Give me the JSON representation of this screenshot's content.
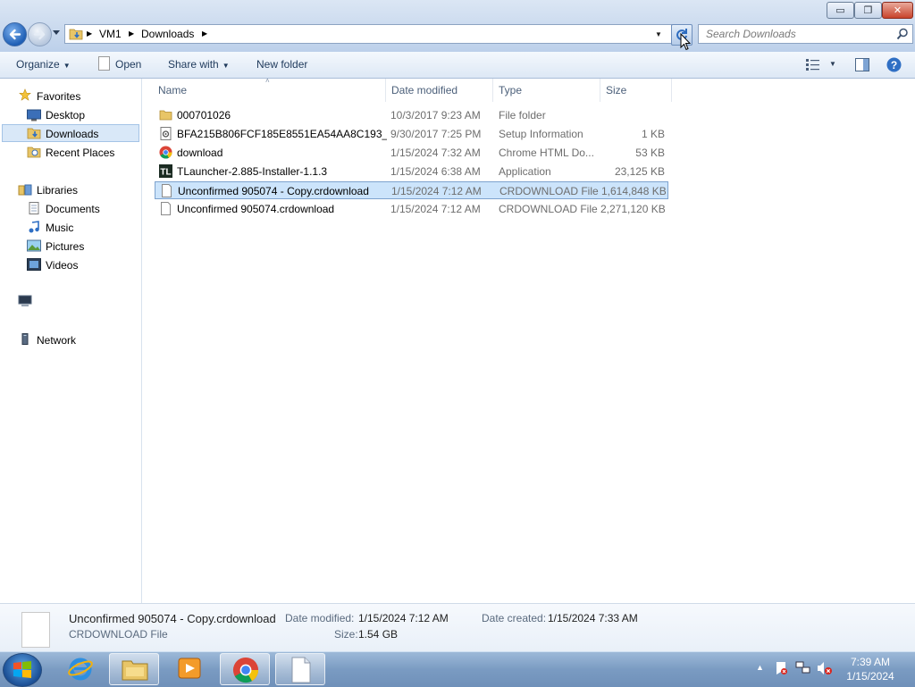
{
  "window": {
    "min_label": "▭",
    "max_label": "❐",
    "close_label": "✕"
  },
  "address": {
    "crumbs": [
      "VM1",
      "Downloads"
    ]
  },
  "search": {
    "placeholder": "Search Downloads"
  },
  "toolbar": {
    "organize": "Organize",
    "open": "Open",
    "share_with": "Share with",
    "new_folder": "New folder"
  },
  "nav": {
    "favorites": "Favorites",
    "desktop": "Desktop",
    "downloads": "Downloads",
    "recent_places": "Recent Places",
    "libraries": "Libraries",
    "documents": "Documents",
    "music": "Music",
    "pictures": "Pictures",
    "videos": "Videos",
    "network": "Network"
  },
  "columns": {
    "name": "Name",
    "date": "Date modified",
    "type": "Type",
    "size": "Size"
  },
  "files": [
    {
      "name": "000701026",
      "date": "10/3/2017 9:23 AM",
      "type": "File folder",
      "size": "",
      "icon": "folder-icon"
    },
    {
      "name": "BFA215B806FCF185E8551EA54AA8C193_...",
      "date": "9/30/2017 7:25 PM",
      "type": "Setup Information",
      "size": "1 KB",
      "icon": "setup-info-icon"
    },
    {
      "name": "download",
      "date": "1/15/2024 7:32 AM",
      "type": "Chrome HTML Do...",
      "size": "53 KB",
      "icon": "chrome-icon"
    },
    {
      "name": "TLauncher-2.885-Installer-1.1.3",
      "date": "1/15/2024 6:38 AM",
      "type": "Application",
      "size": "23,125 KB",
      "icon": "tlauncher-icon"
    },
    {
      "name": "Unconfirmed 905074 - Copy.crdownload",
      "date": "1/15/2024 7:12 AM",
      "type": "CRDOWNLOAD File",
      "size": "1,614,848 KB",
      "icon": "file-icon",
      "selected": true
    },
    {
      "name": "Unconfirmed 905074.crdownload",
      "date": "1/15/2024 7:12 AM",
      "type": "CRDOWNLOAD File",
      "size": "2,271,120 KB",
      "icon": "file-icon"
    }
  ],
  "details": {
    "filename": "Unconfirmed 905074 - Copy.crdownload",
    "filetype": "CRDOWNLOAD File",
    "modified_label": "Date modified:",
    "modified_value": "1/15/2024 7:12 AM",
    "created_label": "Date created:",
    "created_value": "1/15/2024 7:33 AM",
    "size_label": "Size:",
    "size_value": "1.54 GB"
  },
  "taskbar": {
    "time": "7:39 AM",
    "date": "1/15/2024"
  },
  "colors": {
    "selection": "#cce4fb",
    "accent": "#1f5fb5"
  }
}
